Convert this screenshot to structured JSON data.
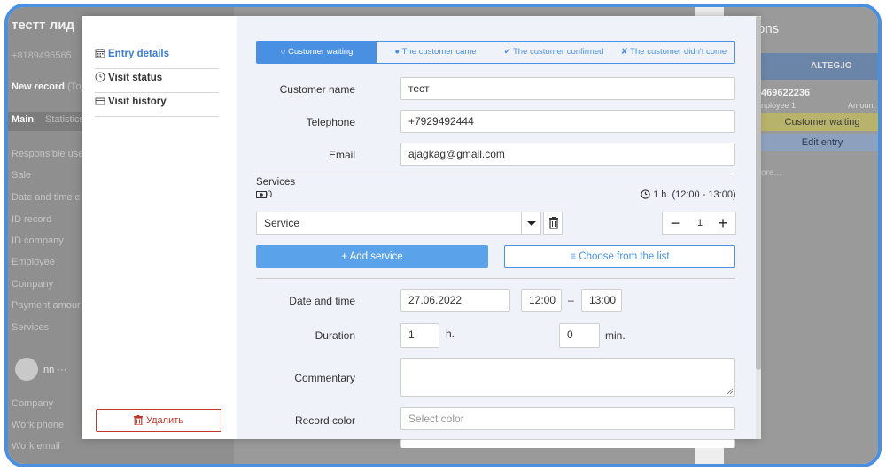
{
  "background": {
    "title": "тестт лид",
    "phone": "+8189496565",
    "new_record": "New record",
    "new_record_suffix": "(Тод",
    "tabs": [
      "Main",
      "Statistics"
    ],
    "fields": [
      "Responsible use",
      "Sale",
      "Date and time c",
      "ID record",
      "ID company",
      "Employee",
      "Company",
      "Payment amour",
      "Services"
    ],
    "contact_name": "nn",
    "contact_fields": [
      "Company",
      "Work phone",
      "Work email"
    ],
    "right_title": "ons",
    "right_header": "ALTEG.IO",
    "right_number": "469622236",
    "right_employee": "nployee 1",
    "right_amount": "Amount",
    "right_status": "Customer waiting",
    "right_edit": "Edit entry",
    "right_more": "ore..."
  },
  "sidebar": {
    "items": [
      {
        "label": "Entry details",
        "icon": "calendar-icon",
        "active": true
      },
      {
        "label": "Visit status",
        "icon": "clock-icon",
        "active": false
      },
      {
        "label": "Visit history",
        "icon": "history-icon",
        "active": false
      }
    ],
    "delete_label": "Удалить"
  },
  "status": {
    "options": [
      {
        "label": "○ Customer waiting",
        "active": true
      },
      {
        "label": "● The customer came",
        "active": false
      },
      {
        "label": "✔ The customer confirmed",
        "active": false
      },
      {
        "label": "✘ The customer didn't come",
        "active": false
      }
    ]
  },
  "form": {
    "customer_name_label": "Customer name",
    "customer_name": "тест",
    "telephone_label": "Telephone",
    "telephone": "+7929492444",
    "email_label": "Email",
    "email": "ajagkag@gmail.com",
    "services_label": "Services",
    "services_count": "0",
    "services_duration": "1 h. (12:00 - 13:00)",
    "service_select": "Service",
    "quantity": "1",
    "add_service": "+ Add service",
    "choose_list": "≡ Choose from the list",
    "date_time_label": "Date and time",
    "date": "27.06.2022",
    "time_from": "12:00",
    "time_to": "13:00",
    "dash": "–",
    "duration_label": "Duration",
    "duration_hours": "1",
    "duration_hours_unit": "h.",
    "duration_minutes": "0",
    "duration_minutes_unit": "min.",
    "commentary_label": "Commentary",
    "commentary": "",
    "record_color_label": "Record color",
    "record_color_placeholder": "Select color"
  },
  "colors": {
    "accent": "#4a90e2",
    "danger": "#c0392b",
    "form_bg": "#f0f2fa"
  }
}
